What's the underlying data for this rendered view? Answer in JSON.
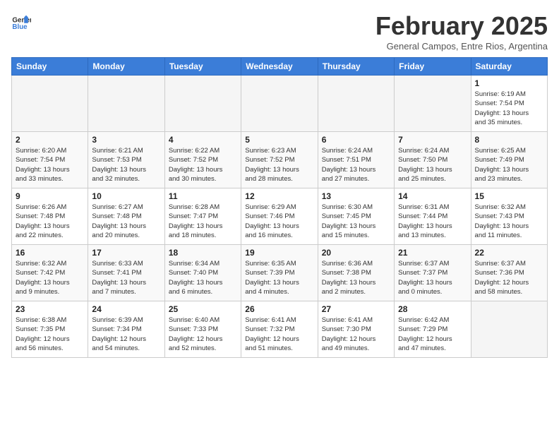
{
  "header": {
    "logo_line1": "General",
    "logo_line2": "Blue",
    "month_title": "February 2025",
    "subtitle": "General Campos, Entre Rios, Argentina"
  },
  "weekdays": [
    "Sunday",
    "Monday",
    "Tuesday",
    "Wednesday",
    "Thursday",
    "Friday",
    "Saturday"
  ],
  "weeks": [
    [
      {
        "day": "",
        "info": ""
      },
      {
        "day": "",
        "info": ""
      },
      {
        "day": "",
        "info": ""
      },
      {
        "day": "",
        "info": ""
      },
      {
        "day": "",
        "info": ""
      },
      {
        "day": "",
        "info": ""
      },
      {
        "day": "1",
        "info": "Sunrise: 6:19 AM\nSunset: 7:54 PM\nDaylight: 13 hours\nand 35 minutes."
      }
    ],
    [
      {
        "day": "2",
        "info": "Sunrise: 6:20 AM\nSunset: 7:54 PM\nDaylight: 13 hours\nand 33 minutes."
      },
      {
        "day": "3",
        "info": "Sunrise: 6:21 AM\nSunset: 7:53 PM\nDaylight: 13 hours\nand 32 minutes."
      },
      {
        "day": "4",
        "info": "Sunrise: 6:22 AM\nSunset: 7:52 PM\nDaylight: 13 hours\nand 30 minutes."
      },
      {
        "day": "5",
        "info": "Sunrise: 6:23 AM\nSunset: 7:52 PM\nDaylight: 13 hours\nand 28 minutes."
      },
      {
        "day": "6",
        "info": "Sunrise: 6:24 AM\nSunset: 7:51 PM\nDaylight: 13 hours\nand 27 minutes."
      },
      {
        "day": "7",
        "info": "Sunrise: 6:24 AM\nSunset: 7:50 PM\nDaylight: 13 hours\nand 25 minutes."
      },
      {
        "day": "8",
        "info": "Sunrise: 6:25 AM\nSunset: 7:49 PM\nDaylight: 13 hours\nand 23 minutes."
      }
    ],
    [
      {
        "day": "9",
        "info": "Sunrise: 6:26 AM\nSunset: 7:48 PM\nDaylight: 13 hours\nand 22 minutes."
      },
      {
        "day": "10",
        "info": "Sunrise: 6:27 AM\nSunset: 7:48 PM\nDaylight: 13 hours\nand 20 minutes."
      },
      {
        "day": "11",
        "info": "Sunrise: 6:28 AM\nSunset: 7:47 PM\nDaylight: 13 hours\nand 18 minutes."
      },
      {
        "day": "12",
        "info": "Sunrise: 6:29 AM\nSunset: 7:46 PM\nDaylight: 13 hours\nand 16 minutes."
      },
      {
        "day": "13",
        "info": "Sunrise: 6:30 AM\nSunset: 7:45 PM\nDaylight: 13 hours\nand 15 minutes."
      },
      {
        "day": "14",
        "info": "Sunrise: 6:31 AM\nSunset: 7:44 PM\nDaylight: 13 hours\nand 13 minutes."
      },
      {
        "day": "15",
        "info": "Sunrise: 6:32 AM\nSunset: 7:43 PM\nDaylight: 13 hours\nand 11 minutes."
      }
    ],
    [
      {
        "day": "16",
        "info": "Sunrise: 6:32 AM\nSunset: 7:42 PM\nDaylight: 13 hours\nand 9 minutes."
      },
      {
        "day": "17",
        "info": "Sunrise: 6:33 AM\nSunset: 7:41 PM\nDaylight: 13 hours\nand 7 minutes."
      },
      {
        "day": "18",
        "info": "Sunrise: 6:34 AM\nSunset: 7:40 PM\nDaylight: 13 hours\nand 6 minutes."
      },
      {
        "day": "19",
        "info": "Sunrise: 6:35 AM\nSunset: 7:39 PM\nDaylight: 13 hours\nand 4 minutes."
      },
      {
        "day": "20",
        "info": "Sunrise: 6:36 AM\nSunset: 7:38 PM\nDaylight: 13 hours\nand 2 minutes."
      },
      {
        "day": "21",
        "info": "Sunrise: 6:37 AM\nSunset: 7:37 PM\nDaylight: 13 hours\nand 0 minutes."
      },
      {
        "day": "22",
        "info": "Sunrise: 6:37 AM\nSunset: 7:36 PM\nDaylight: 12 hours\nand 58 minutes."
      }
    ],
    [
      {
        "day": "23",
        "info": "Sunrise: 6:38 AM\nSunset: 7:35 PM\nDaylight: 12 hours\nand 56 minutes."
      },
      {
        "day": "24",
        "info": "Sunrise: 6:39 AM\nSunset: 7:34 PM\nDaylight: 12 hours\nand 54 minutes."
      },
      {
        "day": "25",
        "info": "Sunrise: 6:40 AM\nSunset: 7:33 PM\nDaylight: 12 hours\nand 52 minutes."
      },
      {
        "day": "26",
        "info": "Sunrise: 6:41 AM\nSunset: 7:32 PM\nDaylight: 12 hours\nand 51 minutes."
      },
      {
        "day": "27",
        "info": "Sunrise: 6:41 AM\nSunset: 7:30 PM\nDaylight: 12 hours\nand 49 minutes."
      },
      {
        "day": "28",
        "info": "Sunrise: 6:42 AM\nSunset: 7:29 PM\nDaylight: 12 hours\nand 47 minutes."
      },
      {
        "day": "",
        "info": ""
      }
    ]
  ]
}
